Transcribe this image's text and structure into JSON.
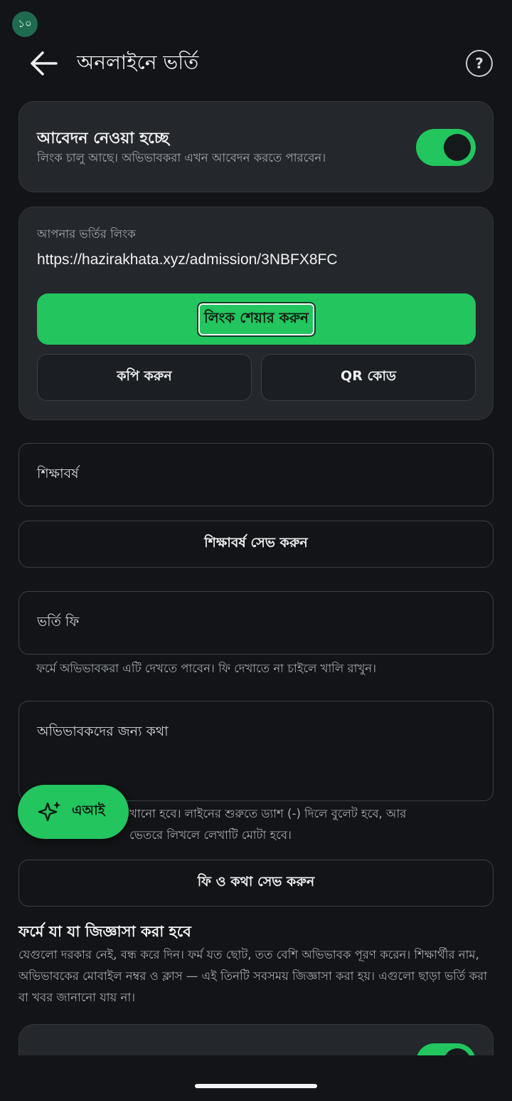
{
  "status": {
    "badge": "১০"
  },
  "appbar": {
    "title": "অনলাইনে ভর্তি"
  },
  "accept_card": {
    "title": "আবেদন নেওয়া হচ্ছে",
    "subtitle": "লিংক চালু আছে। অভিভাবকরা এখন আবেদন করতে পারবেন।",
    "toggle_on": true
  },
  "link_card": {
    "label": "আপনার ভর্তির লিংক",
    "url": "https://hazirakhata.xyz/admission/3NBFX8FC",
    "share_label": "লিংক শেয়ার করুন",
    "copy_label": "কপি করুন",
    "qr_label": "QR কোড"
  },
  "session": {
    "placeholder": "শিক্ষাবর্ষ",
    "save_label": "শিক্ষাবর্ষ সেভ করুন"
  },
  "fee": {
    "placeholder": "ভর্তি ফি",
    "helper": "ফর্মে অভিভাবকরা এটি দেখতে পাবেন। ফি দেখাতে না চাইলে খালি রাখুন।"
  },
  "note": {
    "placeholder": "অভিভাবকদের জন্য কথা",
    "helper_line1": "খানো হবে। লাইনের শুরুতে ড্যাশ (-) দিলে বুলেট হবে, আর",
    "helper_line2": "ভেতরে লিখলে লেখাটি মোটা হবে।",
    "save_label": "ফি ও কথা সেভ করুন"
  },
  "fab": {
    "label": "এআই"
  },
  "questions": {
    "title": "ফর্মে যা যা জিজ্ঞাসা করা হবে",
    "description": "যেগুলো দরকার নেই, বন্ধ করে দিন। ফর্ম যত ছোট, তত বেশি অভিভাবক পূরণ করেন। শিক্ষার্থীর নাম, অভিভাবকের মোবাইল নম্বর ও ক্লাস — এই তিনটি সবসময় জিজ্ঞাসা করা হয়। এগুলো ছাড়া ভর্তি করা বা খবর জানানো যায় না।",
    "first_item_toggle_on": true
  },
  "colors": {
    "accent": "#22c55e",
    "background": "#121417",
    "card": "#24272c"
  }
}
